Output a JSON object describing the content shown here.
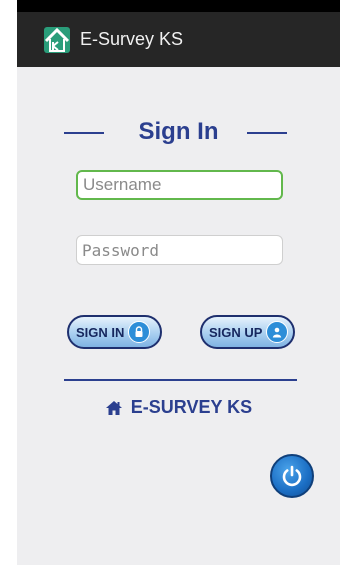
{
  "app_bar": {
    "title": "E-Survey KS",
    "logo_icon": "ks-house-logo-icon"
  },
  "signin_form": {
    "heading": "Sign In",
    "username_placeholder": "Username",
    "password_placeholder": "Password",
    "signin_label": "SIGN IN",
    "signup_label": "SIGN UP"
  },
  "brand": {
    "text": "E-SURVEY KS",
    "icon": "home-icon"
  },
  "power": {
    "icon": "power-icon"
  },
  "colors": {
    "accent": "#2b3f8f",
    "field_focus": "#62b84c",
    "button_blue": "#2d8ed8"
  }
}
